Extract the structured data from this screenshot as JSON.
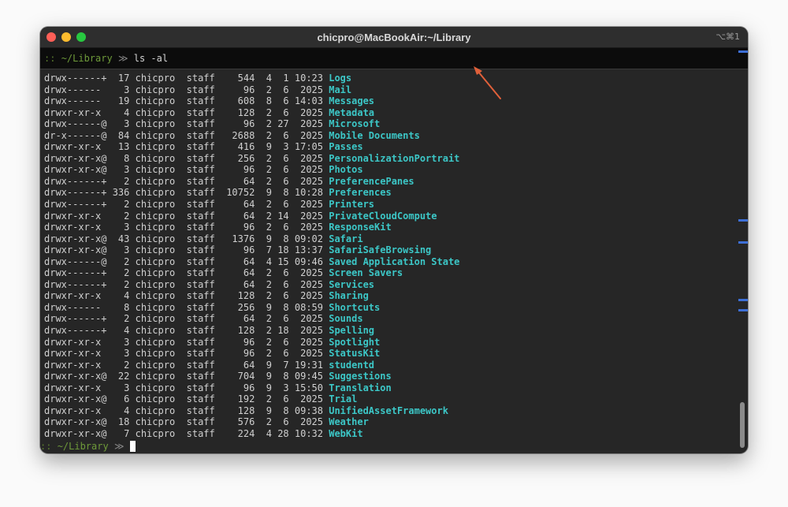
{
  "window": {
    "title": "chicpro@MacBookAir:~/Library",
    "shortcut": "⌥⌘1"
  },
  "command": {
    "prompt_sep": "::",
    "prompt_path": "~/Library",
    "prompt_arrow": "≫",
    "text": "ls -al"
  },
  "rows": [
    {
      "perm": "drwx------+",
      "links": "17",
      "user": "chicpro",
      "group": "staff",
      "size": "544",
      "month": "4",
      "day": "1",
      "time": "10:23",
      "name": "Logs"
    },
    {
      "perm": "drwx------",
      "links": "3",
      "user": "chicpro",
      "group": "staff",
      "size": "96",
      "month": "2",
      "day": "6",
      "time": "2025",
      "name": "Mail"
    },
    {
      "perm": "drwx------",
      "links": "19",
      "user": "chicpro",
      "group": "staff",
      "size": "608",
      "month": "8",
      "day": "6",
      "time": "14:03",
      "name": "Messages"
    },
    {
      "perm": "drwxr-xr-x",
      "links": "4",
      "user": "chicpro",
      "group": "staff",
      "size": "128",
      "month": "2",
      "day": "6",
      "time": "2025",
      "name": "Metadata"
    },
    {
      "perm": "drwx------@",
      "links": "3",
      "user": "chicpro",
      "group": "staff",
      "size": "96",
      "month": "2",
      "day": "27",
      "time": "2025",
      "name": "Microsoft"
    },
    {
      "perm": "dr-x------@",
      "links": "84",
      "user": "chicpro",
      "group": "staff",
      "size": "2688",
      "month": "2",
      "day": "6",
      "time": "2025",
      "name": "Mobile Documents"
    },
    {
      "perm": "drwxr-xr-x",
      "links": "13",
      "user": "chicpro",
      "group": "staff",
      "size": "416",
      "month": "9",
      "day": "3",
      "time": "17:05",
      "name": "Passes"
    },
    {
      "perm": "drwxr-xr-x@",
      "links": "8",
      "user": "chicpro",
      "group": "staff",
      "size": "256",
      "month": "2",
      "day": "6",
      "time": "2025",
      "name": "PersonalizationPortrait"
    },
    {
      "perm": "drwxr-xr-x@",
      "links": "3",
      "user": "chicpro",
      "group": "staff",
      "size": "96",
      "month": "2",
      "day": "6",
      "time": "2025",
      "name": "Photos"
    },
    {
      "perm": "drwx------+",
      "links": "2",
      "user": "chicpro",
      "group": "staff",
      "size": "64",
      "month": "2",
      "day": "6",
      "time": "2025",
      "name": "PreferencePanes"
    },
    {
      "perm": "drwx------+",
      "links": "336",
      "user": "chicpro",
      "group": "staff",
      "size": "10752",
      "month": "9",
      "day": "8",
      "time": "10:28",
      "name": "Preferences"
    },
    {
      "perm": "drwx------+",
      "links": "2",
      "user": "chicpro",
      "group": "staff",
      "size": "64",
      "month": "2",
      "day": "6",
      "time": "2025",
      "name": "Printers"
    },
    {
      "perm": "drwxr-xr-x",
      "links": "2",
      "user": "chicpro",
      "group": "staff",
      "size": "64",
      "month": "2",
      "day": "14",
      "time": "2025",
      "name": "PrivateCloudCompute"
    },
    {
      "perm": "drwxr-xr-x",
      "links": "3",
      "user": "chicpro",
      "group": "staff",
      "size": "96",
      "month": "2",
      "day": "6",
      "time": "2025",
      "name": "ResponseKit"
    },
    {
      "perm": "drwxr-xr-x@",
      "links": "43",
      "user": "chicpro",
      "group": "staff",
      "size": "1376",
      "month": "9",
      "day": "8",
      "time": "09:02",
      "name": "Safari"
    },
    {
      "perm": "drwxr-xr-x@",
      "links": "3",
      "user": "chicpro",
      "group": "staff",
      "size": "96",
      "month": "7",
      "day": "18",
      "time": "13:37",
      "name": "SafariSafeBrowsing"
    },
    {
      "perm": "drwx------@",
      "links": "2",
      "user": "chicpro",
      "group": "staff",
      "size": "64",
      "month": "4",
      "day": "15",
      "time": "09:46",
      "name": "Saved Application State"
    },
    {
      "perm": "drwx------+",
      "links": "2",
      "user": "chicpro",
      "group": "staff",
      "size": "64",
      "month": "2",
      "day": "6",
      "time": "2025",
      "name": "Screen Savers"
    },
    {
      "perm": "drwx------+",
      "links": "2",
      "user": "chicpro",
      "group": "staff",
      "size": "64",
      "month": "2",
      "day": "6",
      "time": "2025",
      "name": "Services"
    },
    {
      "perm": "drwxr-xr-x",
      "links": "4",
      "user": "chicpro",
      "group": "staff",
      "size": "128",
      "month": "2",
      "day": "6",
      "time": "2025",
      "name": "Sharing"
    },
    {
      "perm": "drwx------",
      "links": "8",
      "user": "chicpro",
      "group": "staff",
      "size": "256",
      "month": "9",
      "day": "8",
      "time": "08:59",
      "name": "Shortcuts"
    },
    {
      "perm": "drwx------+",
      "links": "2",
      "user": "chicpro",
      "group": "staff",
      "size": "64",
      "month": "2",
      "day": "6",
      "time": "2025",
      "name": "Sounds"
    },
    {
      "perm": "drwx------+",
      "links": "4",
      "user": "chicpro",
      "group": "staff",
      "size": "128",
      "month": "2",
      "day": "18",
      "time": "2025",
      "name": "Spelling"
    },
    {
      "perm": "drwxr-xr-x",
      "links": "3",
      "user": "chicpro",
      "group": "staff",
      "size": "96",
      "month": "2",
      "day": "6",
      "time": "2025",
      "name": "Spotlight"
    },
    {
      "perm": "drwxr-xr-x",
      "links": "3",
      "user": "chicpro",
      "group": "staff",
      "size": "96",
      "month": "2",
      "day": "6",
      "time": "2025",
      "name": "StatusKit"
    },
    {
      "perm": "drwxr-xr-x",
      "links": "2",
      "user": "chicpro",
      "group": "staff",
      "size": "64",
      "month": "9",
      "day": "7",
      "time": "19:31",
      "name": "studentd"
    },
    {
      "perm": "drwxr-xr-x@",
      "links": "22",
      "user": "chicpro",
      "group": "staff",
      "size": "704",
      "month": "9",
      "day": "8",
      "time": "09:45",
      "name": "Suggestions"
    },
    {
      "perm": "drwxr-xr-x",
      "links": "3",
      "user": "chicpro",
      "group": "staff",
      "size": "96",
      "month": "9",
      "day": "3",
      "time": "15:50",
      "name": "Translation"
    },
    {
      "perm": "drwxr-xr-x@",
      "links": "6",
      "user": "chicpro",
      "group": "staff",
      "size": "192",
      "month": "2",
      "day": "6",
      "time": "2025",
      "name": "Trial"
    },
    {
      "perm": "drwxr-xr-x",
      "links": "4",
      "user": "chicpro",
      "group": "staff",
      "size": "128",
      "month": "9",
      "day": "8",
      "time": "09:38",
      "name": "UnifiedAssetFramework"
    },
    {
      "perm": "drwxr-xr-x@",
      "links": "18",
      "user": "chicpro",
      "group": "staff",
      "size": "576",
      "month": "2",
      "day": "6",
      "time": "2025",
      "name": "Weather"
    },
    {
      "perm": "drwxr-xr-x@",
      "links": "7",
      "user": "chicpro",
      "group": "staff",
      "size": "224",
      "month": "4",
      "day": "28",
      "time": "10:32",
      "name": "WebKit"
    }
  ],
  "prompt": {
    "sep": "::",
    "path": "~/Library",
    "arrow": "≫"
  },
  "colors": {
    "filename": "#3cc7c7",
    "prompt_path": "#6e9a3a",
    "annotation_arrow": "#e0603a",
    "scroll_marker": "#3d6fd6"
  }
}
